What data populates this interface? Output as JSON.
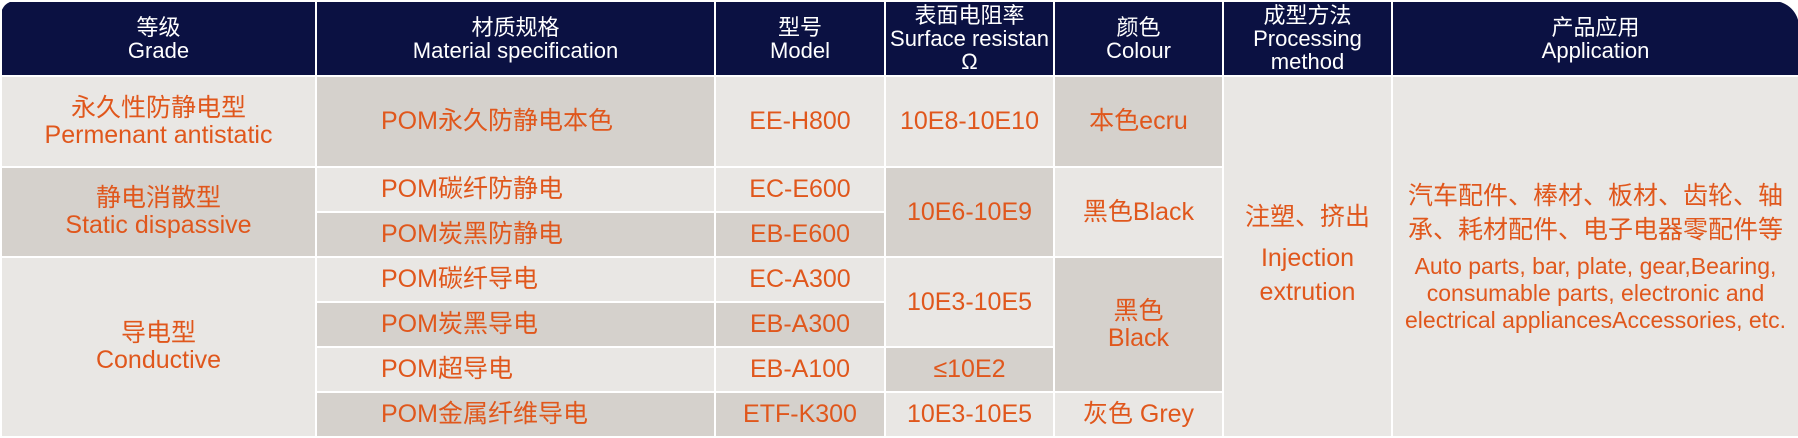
{
  "headers": [
    {
      "cn": "等级",
      "en": "Grade"
    },
    {
      "cn": "材质规格",
      "en": "Material specification"
    },
    {
      "cn": "型号",
      "en": "Model"
    },
    {
      "cn": "表面电阻率",
      "en": "Surface resistan Ω"
    },
    {
      "cn": "颜色",
      "en": "Colour"
    },
    {
      "cn": "成型方法",
      "en": "Processing method"
    },
    {
      "cn": "产品应用",
      "en": "Application"
    }
  ],
  "grades": [
    {
      "cn": "永久性防静电型",
      "en": "Permenant antistatic"
    },
    {
      "cn": "静电消散型",
      "en": "Static dispassive"
    },
    {
      "cn": "导电型",
      "en": "Conductive"
    }
  ],
  "materials": [
    "POM永久防静电本色",
    "POM碳纤防静电",
    "POM炭黑防静电",
    "POM碳纤导电",
    "POM炭黑导电",
    "POM超导电",
    "POM金属纤维导电"
  ],
  "models": [
    "EE-H800",
    "EC-E600",
    "EB-E600",
    "EC-A300",
    "EB-A300",
    "EB-A100",
    "ETF-K300"
  ],
  "resistance": [
    "10E8-10E10",
    "10E6-10E9",
    "10E3-10E5",
    "≤10E2",
    "10E3-10E5"
  ],
  "colours": [
    "本色ecru",
    "黑色Black",
    "黑色 Black",
    "灰色 Grey"
  ],
  "processing": {
    "cn": "注塑、挤出",
    "en": "Injection extrution"
  },
  "application": {
    "cn": "汽车配件、棒材、板材、齿轮、轴承、耗材配件、电子电器零配件等",
    "en": "Auto parts, bar, plate, gear,Bearing, consumable parts, electronic and electrical appliancesAccessories, etc."
  },
  "colors": {
    "header_bg": "#0b1142",
    "header_text": "#ffffff",
    "body_text": "#e0571c",
    "cell_light": "#e9e7e4",
    "cell_dark": "#d5d1cc"
  }
}
